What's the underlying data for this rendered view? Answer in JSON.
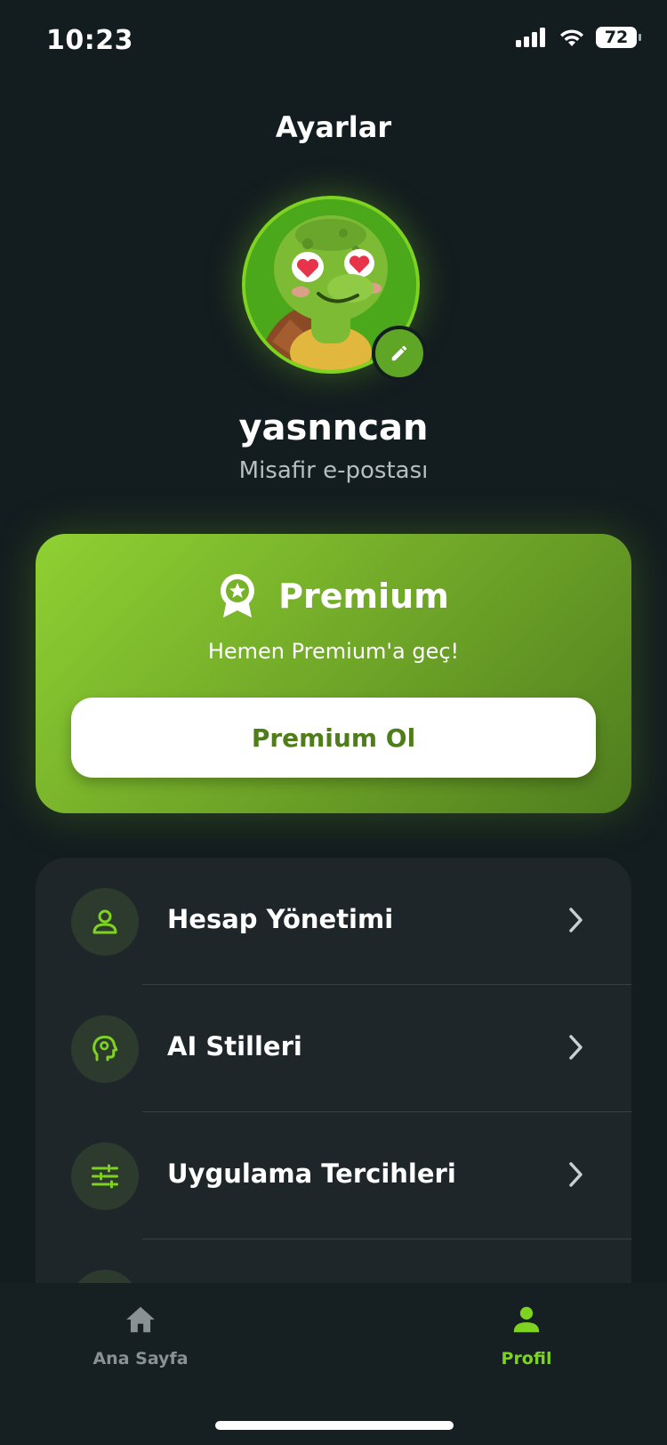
{
  "status_bar": {
    "time": "10:23",
    "battery": "72"
  },
  "header": {
    "title": "Ayarlar"
  },
  "profile": {
    "username": "yasnncan",
    "email": "Misafir e-postası"
  },
  "premium": {
    "title": "Premium",
    "subtitle": "Hemen Premium'a geç!",
    "button_label": "Premium Ol"
  },
  "menu": {
    "items": [
      {
        "label": "Hesap Yönetimi",
        "icon": "person-icon"
      },
      {
        "label": "AI Stilleri",
        "icon": "brain-head-icon"
      },
      {
        "label": "Uygulama Tercihleri",
        "icon": "sliders-icon"
      }
    ]
  },
  "tabs": [
    {
      "label": "Ana Sayfa",
      "icon": "home-icon",
      "active": false
    },
    {
      "label": "Profil",
      "icon": "profile-icon",
      "active": true
    }
  ],
  "colors": {
    "accent": "#7ed321",
    "background": "#131c1f",
    "card": "#1e2629",
    "inactive_tab": "#8a9194"
  }
}
